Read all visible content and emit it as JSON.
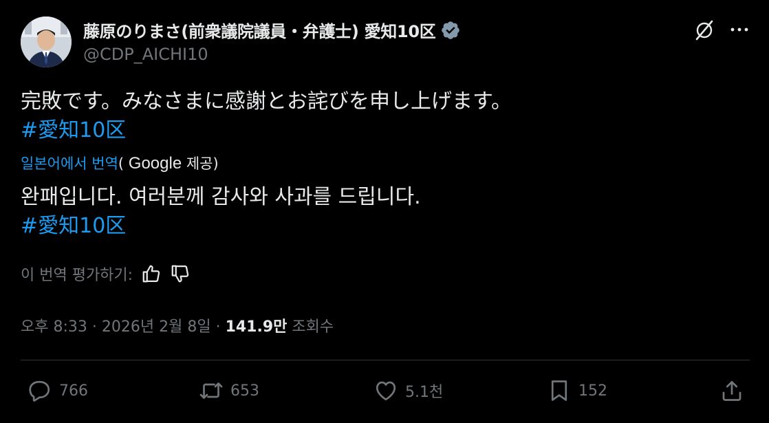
{
  "author": {
    "display_name": "藤原のりまさ(前衆議院議員・弁護士) 愛知10区",
    "handle": "@CDP_AICHI10",
    "verified_color": "#829aab"
  },
  "tweet": {
    "text": "完敗です。みなさまに感謝とお詫びを申し上げます。",
    "hashtag": "#愛知10区"
  },
  "translation": {
    "source_link": "일본어에서 번역",
    "open_paren": "(",
    "provider": " Google",
    "provider_suffix": " 제공)",
    "text": "완패입니다. 여러분께 감사와 사과를 드립니다.",
    "hashtag": "#愛知10区",
    "rate_label": "이 번역 평가하기:"
  },
  "meta": {
    "time": "오후 8:33",
    "separator1": " · ",
    "date": "2026년 2월 8일",
    "separator2": " · ",
    "views_count": "141.9만",
    "views_label": " 조회수"
  },
  "actions": {
    "replies": "766",
    "reposts": "653",
    "likes": "5.1천",
    "bookmarks": "152"
  },
  "colors": {
    "background": "#000000",
    "text": "#e7e9ea",
    "secondary": "#71767b",
    "accent": "#1d9bf0",
    "divider": "#2f3336"
  },
  "icons": [
    "grok-icon",
    "more-icon",
    "thumbs-up-icon",
    "thumbs-down-icon",
    "reply-icon",
    "repost-icon",
    "like-icon",
    "bookmark-icon",
    "share-icon"
  ]
}
